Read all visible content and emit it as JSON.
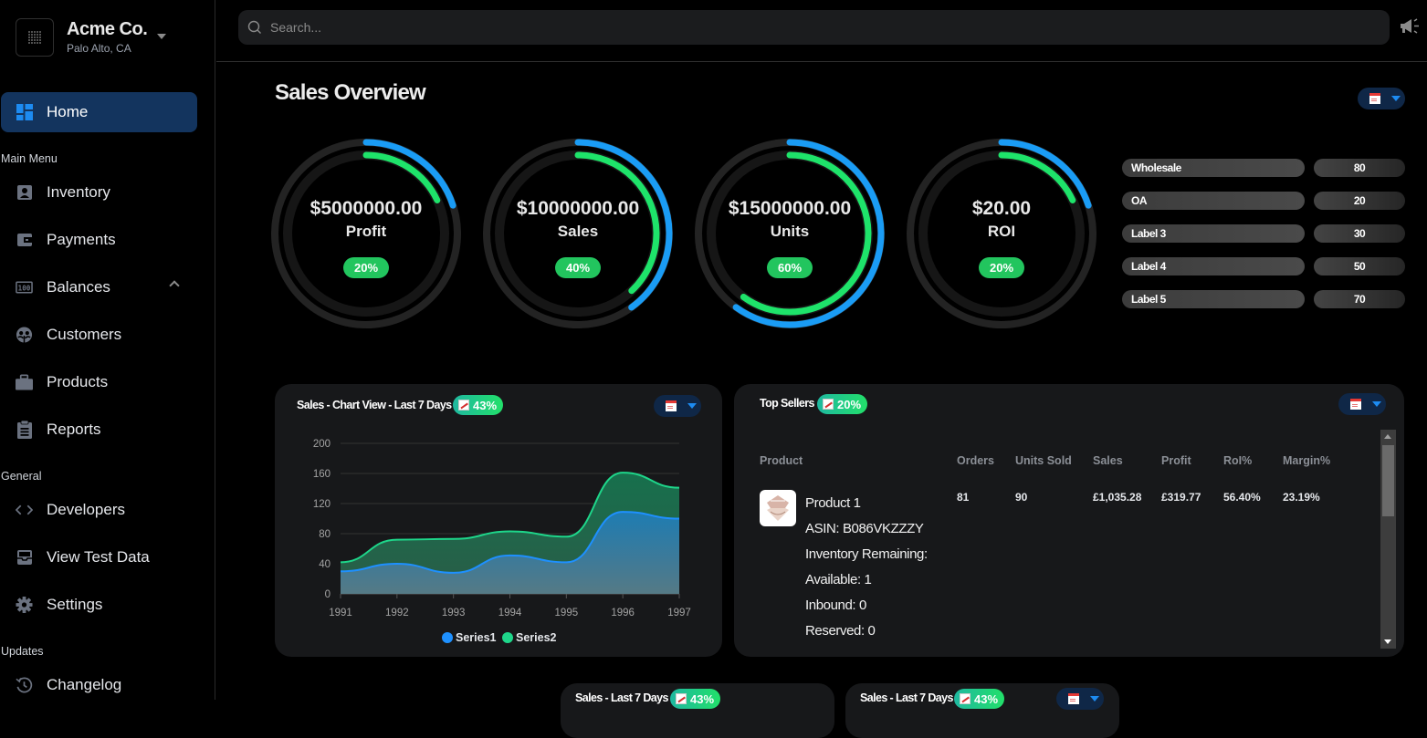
{
  "brand": {
    "name": "Acme Co.",
    "location": "Palo Alto, CA"
  },
  "sidebar": {
    "home": {
      "label": "Home",
      "icon": "dashboard-icon"
    },
    "sections": [
      {
        "label": "Main Menu"
      },
      {
        "label": "General"
      },
      {
        "label": "Updates"
      }
    ],
    "items": [
      {
        "label": "Inventory",
        "icon": "contact-card-icon"
      },
      {
        "label": "Payments",
        "icon": "wallet-icon"
      },
      {
        "label": "Balances",
        "icon": "counter-icon",
        "expanded": true
      },
      {
        "label": "Customers",
        "icon": "customers-icon"
      },
      {
        "label": "Products",
        "icon": "briefcase-icon"
      },
      {
        "label": "Reports",
        "icon": "clipboard-icon"
      },
      {
        "label": "Developers",
        "icon": "code-icon"
      },
      {
        "label": "View Test Data",
        "icon": "inbox-icon"
      },
      {
        "label": "Settings",
        "icon": "gear-icon"
      },
      {
        "label": "Changelog",
        "icon": "history-icon"
      }
    ]
  },
  "search": {
    "placeholder": "Search..."
  },
  "page": {
    "title": "Sales Overview"
  },
  "gauges": [
    {
      "value": "$5000000.00",
      "label": "Profit",
      "percent_label": "20%",
      "outer_fraction": 0.2,
      "inner_fraction": 0.18
    },
    {
      "value": "$10000000.00",
      "label": "Sales",
      "percent_label": "40%",
      "outer_fraction": 0.4,
      "inner_fraction": 0.38
    },
    {
      "value": "$15000000.00",
      "label": "Units",
      "percent_label": "60%",
      "outer_fraction": 0.6,
      "inner_fraction": 0.6
    },
    {
      "value": "$20.00",
      "label": "ROI",
      "percent_label": "20%",
      "outer_fraction": 0.2,
      "inner_fraction": 0.18
    }
  ],
  "breakdown": [
    {
      "label": "Wholesale",
      "value": "80"
    },
    {
      "label": "OA",
      "value": "20"
    },
    {
      "label": "Label 3",
      "value": "30"
    },
    {
      "label": "Label 4",
      "value": "50"
    },
    {
      "label": "Label 5",
      "value": "70"
    }
  ],
  "sales_chart_card": {
    "title": "Sales - Chart View - Last 7 Days",
    "badge": "43%"
  },
  "chart_data": {
    "type": "area",
    "title": "Sales - Chart View - Last 7 Days",
    "x": [
      "1991",
      "1992",
      "1993",
      "1994",
      "1995",
      "1996",
      "1997"
    ],
    "series": [
      {
        "name": "Series1",
        "color": "#1e90ff",
        "values": [
          30,
          40,
          28,
          51,
          42,
          109,
          100
        ]
      },
      {
        "name": "Series2",
        "color": "#1ed68a",
        "values": [
          42,
          72,
          73,
          83,
          76,
          161,
          141
        ]
      }
    ],
    "yticks": [
      "0",
      "40",
      "80",
      "120",
      "160",
      "200"
    ],
    "ylim": [
      0,
      200
    ],
    "grid": true,
    "legend": "bottom-center",
    "xlabel": "",
    "ylabel": ""
  },
  "top_sellers": {
    "title": "Top Sellers",
    "badge": "20%",
    "columns": [
      "Product",
      "Orders",
      "Units Sold",
      "Sales",
      "Profit",
      "RoI%",
      "Margin%"
    ],
    "rows": [
      {
        "name": "Product 1",
        "asin": "ASIN: B086VKZZZY",
        "inventory": "Inventory Remaining:",
        "available": "Available: 1",
        "inbound": "Inbound: 0",
        "reserved": "Reserved: 0",
        "orders": "81",
        "units_sold": "90",
        "sales": "£1,035.28",
        "profit": "£319.77",
        "roi": "56.40%",
        "margin": "23.19%"
      }
    ]
  },
  "bottom_cards": [
    {
      "title": "Sales - Last 7 Days",
      "badge": "43%"
    },
    {
      "title": "Sales - Last 7 Days",
      "badge": "43%"
    }
  ]
}
